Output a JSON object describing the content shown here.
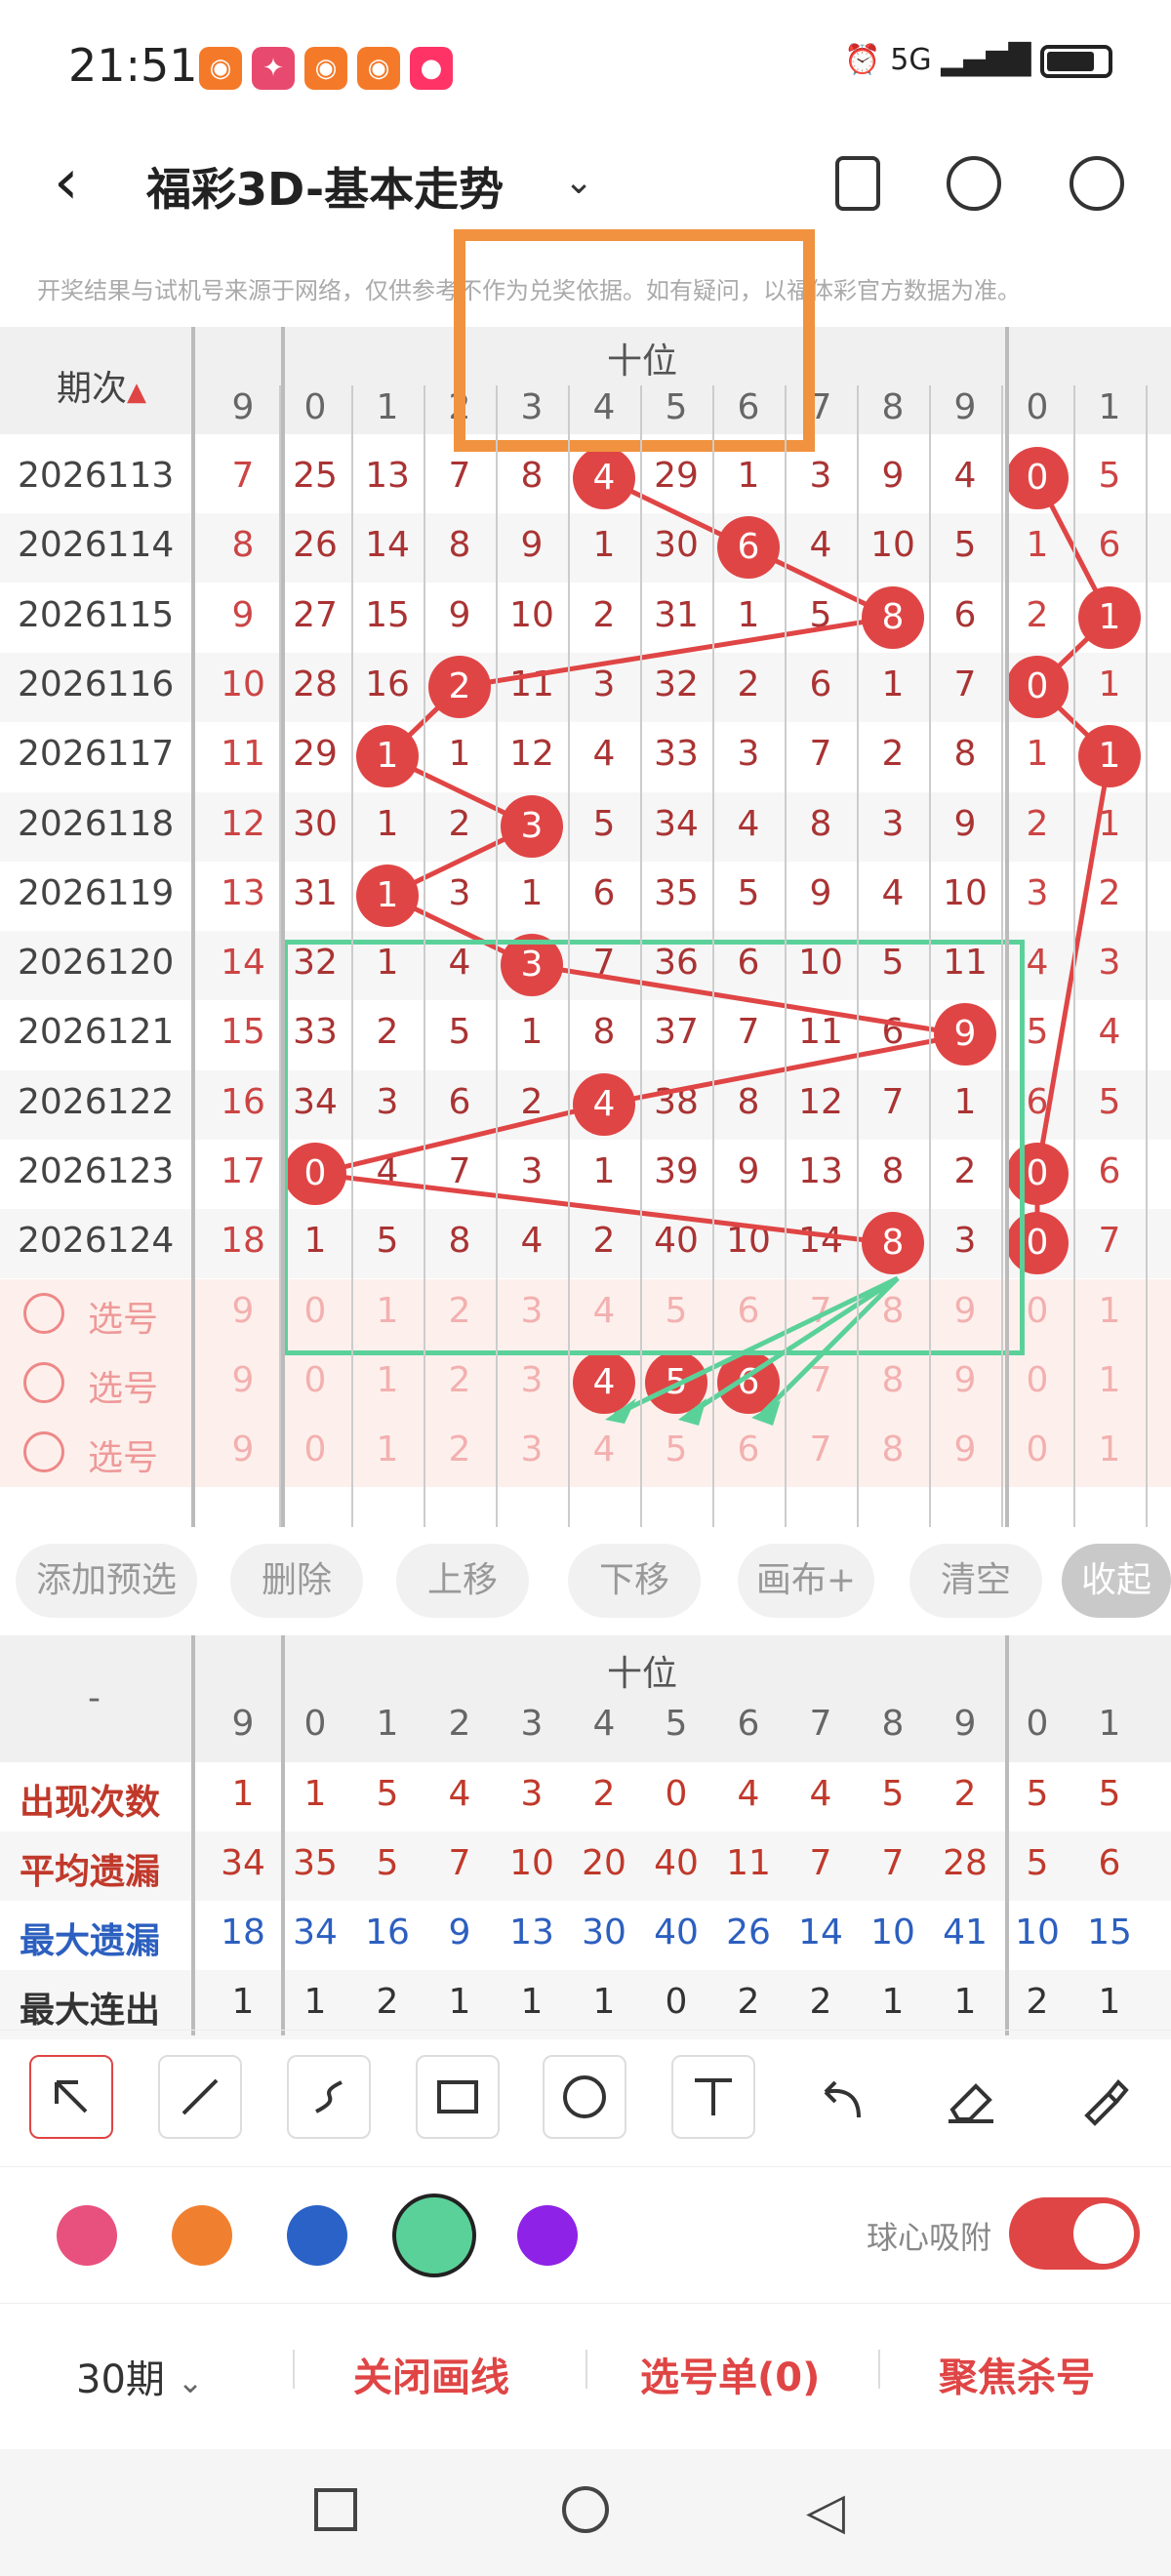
{
  "status_bar": {
    "time": "21:51",
    "network": "5G",
    "battery_icon": "battery-icon",
    "alarm_icon": "alarm-icon"
  },
  "header": {
    "title": "福彩3D-基本走势",
    "disclaimer": "开奖结果与试机号来源于网络，仅供参考不作为兑奖依据。如有疑问，以福体彩官方数据为准。"
  },
  "table": {
    "period_header": "期次",
    "group_header": "十位",
    "columns": [
      "9",
      "0",
      "1",
      "2",
      "3",
      "4",
      "5",
      "6",
      "7",
      "8",
      "9",
      "0",
      "1"
    ],
    "rows": [
      {
        "period": "2026113",
        "cells": [
          "7",
          "25",
          "13",
          "7",
          "8",
          "4",
          "29",
          "1",
          "3",
          "9",
          "4",
          "0",
          "5"
        ],
        "hit_tens": 4,
        "hit_units": 0
      },
      {
        "period": "2026114",
        "cells": [
          "8",
          "26",
          "14",
          "8",
          "9",
          "1",
          "30",
          "6",
          "4",
          "10",
          "5",
          "1",
          "6"
        ],
        "hit_tens": 6,
        "hit_units": null
      },
      {
        "period": "2026115",
        "cells": [
          "9",
          "27",
          "15",
          "9",
          "10",
          "2",
          "31",
          "1",
          "5",
          "8",
          "6",
          "2",
          "1"
        ],
        "hit_tens": 8,
        "hit_units": 1
      },
      {
        "period": "2026116",
        "cells": [
          "10",
          "28",
          "16",
          "2",
          "11",
          "3",
          "32",
          "2",
          "6",
          "1",
          "7",
          "0",
          "1"
        ],
        "hit_tens": 2,
        "hit_units": 0
      },
      {
        "period": "2026117",
        "cells": [
          "11",
          "29",
          "1",
          "1",
          "12",
          "4",
          "33",
          "3",
          "7",
          "2",
          "8",
          "1",
          "1"
        ],
        "hit_tens": 1,
        "hit_units": 1
      },
      {
        "period": "2026118",
        "cells": [
          "12",
          "30",
          "1",
          "2",
          "3",
          "5",
          "34",
          "4",
          "8",
          "3",
          "9",
          "2",
          "1"
        ],
        "hit_tens": 3,
        "hit_units": null
      },
      {
        "period": "2026119",
        "cells": [
          "13",
          "31",
          "1",
          "3",
          "1",
          "6",
          "35",
          "5",
          "9",
          "4",
          "10",
          "3",
          "2"
        ],
        "hit_tens": 1,
        "hit_units": null
      },
      {
        "period": "2026120",
        "cells": [
          "14",
          "32",
          "1",
          "4",
          "3",
          "7",
          "36",
          "6",
          "10",
          "5",
          "11",
          "4",
          "3"
        ],
        "hit_tens": 3,
        "hit_units": null
      },
      {
        "period": "2026121",
        "cells": [
          "15",
          "33",
          "2",
          "5",
          "1",
          "8",
          "37",
          "7",
          "11",
          "6",
          "9",
          "5",
          "4"
        ],
        "hit_tens": 9,
        "hit_units": null
      },
      {
        "period": "2026122",
        "cells": [
          "16",
          "34",
          "3",
          "6",
          "2",
          "4",
          "38",
          "8",
          "12",
          "7",
          "1",
          "6",
          "5"
        ],
        "hit_tens": 4,
        "hit_units": null
      },
      {
        "period": "2026123",
        "cells": [
          "17",
          "0",
          "4",
          "7",
          "3",
          "1",
          "39",
          "9",
          "13",
          "8",
          "2",
          "0",
          "6"
        ],
        "hit_tens": 0,
        "hit_units": 0
      },
      {
        "period": "2026124",
        "cells": [
          "18",
          "1",
          "5",
          "8",
          "4",
          "2",
          "40",
          "10",
          "14",
          "8",
          "3",
          "0",
          "7"
        ],
        "hit_tens": 8,
        "hit_units": 0
      }
    ],
    "pick_rows": [
      {
        "label": "选号",
        "cells": [
          "9",
          "0",
          "1",
          "2",
          "3",
          "4",
          "5",
          "6",
          "7",
          "8",
          "9",
          "0",
          "1"
        ],
        "picked": []
      },
      {
        "label": "选号",
        "cells": [
          "9",
          "0",
          "1",
          "2",
          "3",
          "4",
          "5",
          "6",
          "7",
          "8",
          "9",
          "0",
          "1"
        ],
        "picked": [
          4,
          5,
          6
        ]
      },
      {
        "label": "选号",
        "cells": [
          "9",
          "0",
          "1",
          "2",
          "3",
          "4",
          "5",
          "6",
          "7",
          "8",
          "9",
          "0",
          "1"
        ],
        "picked": []
      }
    ]
  },
  "actions": [
    "添加预选",
    "删除",
    "上移",
    "下移",
    "画布+",
    "清空",
    "收起"
  ],
  "stats": {
    "dash": "-",
    "group_header": "十位",
    "columns": [
      "9",
      "0",
      "1",
      "2",
      "3",
      "4",
      "5",
      "6",
      "7",
      "8",
      "9",
      "0",
      "1"
    ],
    "rows": [
      {
        "label": "出现次数",
        "color": "#c0392b",
        "values": [
          "1",
          "1",
          "5",
          "4",
          "3",
          "2",
          "0",
          "4",
          "4",
          "5",
          "2",
          "5",
          "5"
        ]
      },
      {
        "label": "平均遗漏",
        "color": "#c0392b",
        "values": [
          "34",
          "35",
          "5",
          "7",
          "10",
          "20",
          "40",
          "11",
          "7",
          "7",
          "28",
          "5",
          "6"
        ]
      },
      {
        "label": "最大遗漏",
        "color": "#2c5fbf",
        "values": [
          "18",
          "34",
          "16",
          "9",
          "13",
          "30",
          "40",
          "26",
          "14",
          "10",
          "41",
          "10",
          "15"
        ]
      },
      {
        "label": "最大连出",
        "color": "#333333",
        "values": [
          "1",
          "1",
          "2",
          "1",
          "1",
          "1",
          "0",
          "2",
          "2",
          "1",
          "1",
          "2",
          "1"
        ]
      }
    ]
  },
  "tools": [
    "cursor-arrow-icon",
    "line-tool-icon",
    "freehand-tool-icon",
    "rectangle-tool-icon",
    "circle-tool-icon",
    "text-tool-icon",
    "undo-icon",
    "eraser-icon",
    "brush-icon"
  ],
  "colors": [
    "#e8517e",
    "#f08030",
    "#2a62c8",
    "#5bd19a",
    "#8e22e6"
  ],
  "snap": {
    "label": "球心吸附",
    "enabled": true
  },
  "bottom": {
    "period_select": "30期",
    "close_lines": "关闭画线",
    "pick_list": "选号单(0)",
    "focus_kill": "聚焦杀号"
  }
}
